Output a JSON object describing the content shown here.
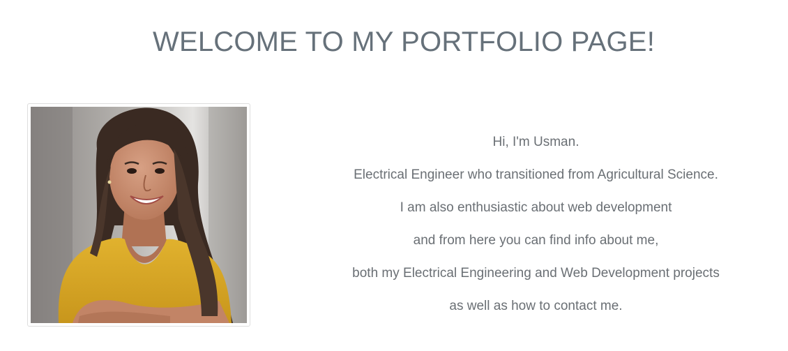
{
  "header": {
    "title": "WELCOME TO MY PORTFOLIO PAGE!"
  },
  "profile": {
    "photo_icon": "portrait-photo",
    "colors": {
      "shirt": "#d9a92a",
      "hair": "#3a2a22",
      "skin": "#c48a6a",
      "background": "#9a9a98"
    }
  },
  "intro": {
    "lines": [
      "Hi, I'm Usman.",
      "Electrical Engineer who transitioned from Agricultural Science.",
      "I am also enthusiastic about web development",
      "and from here you can find info about me,",
      "both my Electrical Engineering and Web Development projects",
      "as well as how to contact me."
    ]
  },
  "theme": {
    "title_color": "#66717a",
    "text_color": "#6a6f74",
    "frame_border": "#dddddd"
  }
}
